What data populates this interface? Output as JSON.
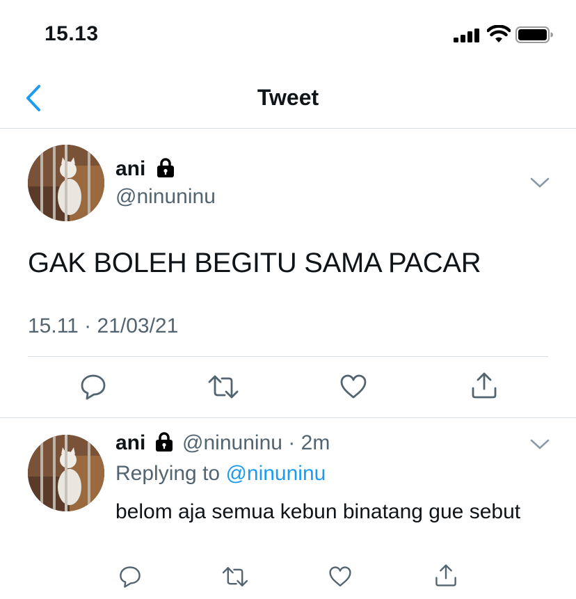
{
  "status_bar": {
    "time": "15.13"
  },
  "nav": {
    "title": "Tweet",
    "back_icon": "chevron-left-icon"
  },
  "tweet": {
    "name": "ani",
    "handle": "@ninuninu",
    "text": "GAK BOLEH BEGITU SAMA PACAR",
    "timestamp": "15.11 · 21/03/21"
  },
  "reply": {
    "name": "ani",
    "handle": "@ninuninu",
    "separator": "·",
    "age": "2m",
    "replying_prefix": "Replying to",
    "replying_to": "@ninuninu",
    "text": "belom aja semua kebun binatang gue sebut"
  },
  "colors": {
    "accent": "#1d9bf0",
    "secondary_text": "#536471",
    "divider": "#d6dbdf"
  }
}
